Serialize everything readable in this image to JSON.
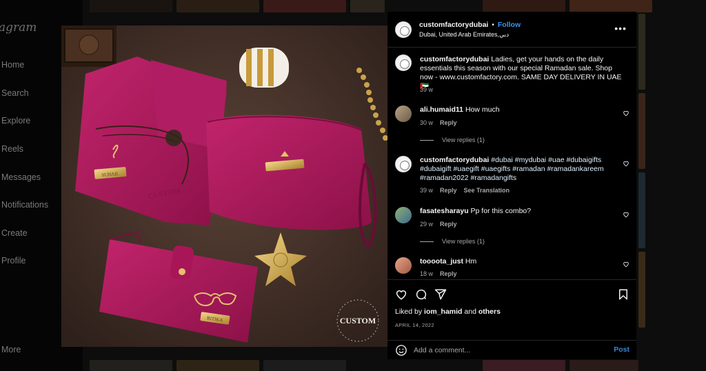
{
  "app": {
    "logo_text": "agram",
    "nav": [
      "Home",
      "Search",
      "Explore",
      "Reels",
      "Messages",
      "Notifications",
      "Create",
      "Profile"
    ],
    "more_label": "More"
  },
  "post": {
    "username": "customfactorydubai",
    "separator": "•",
    "follow_label": "Follow",
    "location": "Dubai, United Arab Emirates,دبي",
    "more_options": "•••",
    "caption": {
      "username": "customfactorydubai",
      "text": "Ladies, get your hands on the daily essentials this season with our special Ramadan sale. Shop now - www.customfactory.com. SAME DAY DELIVERY IN UAE 🇦🇪",
      "age": "39 w"
    },
    "comments": [
      {
        "username": "ali.humaid11",
        "text": "How much",
        "age": "30 w",
        "reply_label": "Reply",
        "view_replies": "View replies (1)"
      },
      {
        "username": "customfactorydubai",
        "text": "#dubai #mydubai #uae #dubaigifts #dubaigift #uaegift #uaegifts #ramadan #ramadankareem #ramadan2022 #ramadangifts",
        "age": "39 w",
        "reply_label": "Reply",
        "translate_label": "See Translation"
      },
      {
        "username": "fasatesharayu",
        "text": "Pp for this combo?",
        "age": "29 w",
        "reply_label": "Reply",
        "view_replies": "View replies (1)"
      },
      {
        "username": "toooota_just",
        "text": "Hm",
        "age": "18 w",
        "reply_label": "Reply"
      }
    ],
    "likes": {
      "prefix": "Liked by",
      "user": "iom_hamid",
      "conj": "and",
      "others": "others"
    },
    "date": "APRIL 14, 2022",
    "comment_placeholder": "Add a comment...",
    "post_label": "Post"
  },
  "image_labels": {
    "tag1": "SUHAIL",
    "tag2": "RITIKA",
    "tag3": "CUSTOM",
    "brand_watermark": "CUSTOM"
  },
  "colors": {
    "accent": "#3897f0",
    "bag": "#b0195f",
    "bag_dark": "#8c1148",
    "gold": "#c9a24a"
  },
  "icons": [
    "heart-icon",
    "comment-icon",
    "share-icon",
    "bookmark-icon",
    "emoji-icon",
    "more-options-icon"
  ]
}
